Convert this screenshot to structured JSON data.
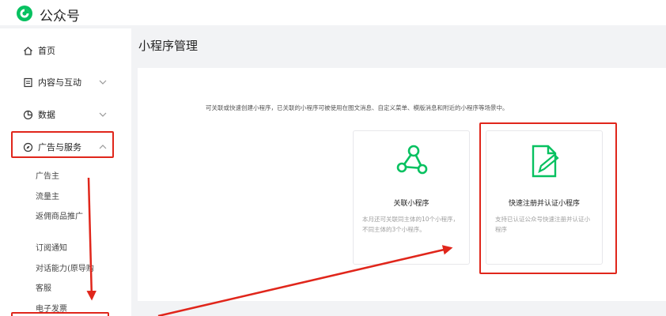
{
  "header": {
    "logo_icon": "wechat-official-account-icon",
    "brand": "公众号"
  },
  "sidebar": {
    "items": [
      {
        "label": "首页",
        "icon": "home-icon",
        "expandable": false
      },
      {
        "label": "内容与互动",
        "icon": "document-icon",
        "expandable": true,
        "expanded": false
      },
      {
        "label": "数据",
        "icon": "pie-chart-icon",
        "expandable": true,
        "expanded": false
      },
      {
        "label": "广告与服务",
        "icon": "compass-icon",
        "expandable": true,
        "expanded": true,
        "highlighted": true
      }
    ],
    "subitems": [
      "广告主",
      "流量主",
      "返佣商品推广",
      "订阅通知",
      "对话能力(原导购",
      "客服",
      "电子发票"
    ]
  },
  "main": {
    "title": "小程序管理",
    "description": "可关联或快速创建小程序，已关联的小程序可被使用在图文消息、自定义菜单、模版消息和附近的小程序等场景中。",
    "cards": [
      {
        "title": "关联小程序",
        "desc": "本月还可关联同主体的10个小程序，不同主体的3个小程序。",
        "icon": "share-nodes-icon"
      },
      {
        "title": "快速注册并认证小程序",
        "desc": "支持已认证公众号快速注册并认证小程序",
        "icon": "edit-document-icon",
        "highlighted": true
      }
    ]
  },
  "colors": {
    "accent_green": "#07c160",
    "annotation_red": "#e0261b",
    "background": "#f2f3f5"
  }
}
